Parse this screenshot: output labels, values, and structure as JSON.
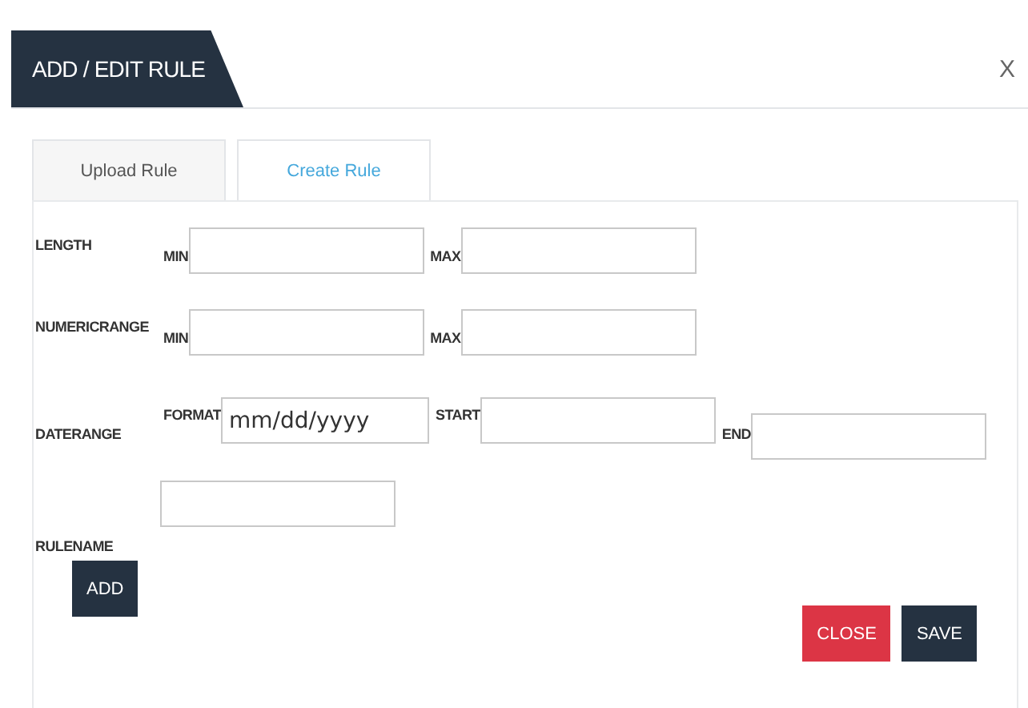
{
  "dialog": {
    "title": "ADD / EDIT RULE",
    "close_glyph": "X"
  },
  "tabs": [
    {
      "label": "Upload Rule",
      "selected": false
    },
    {
      "label": "Create Rule",
      "selected": true
    }
  ],
  "rows": [
    {
      "label": "LENGTH",
      "kind": "pair",
      "fields": [
        {
          "label": "MIN"
        },
        {
          "label": "MAX"
        }
      ]
    },
    {
      "label": "NUMERICRANGE",
      "kind": "pair",
      "fields": [
        {
          "label": "MIN"
        },
        {
          "label": "MAX"
        }
      ]
    },
    {
      "label": "DATERANGE",
      "kind": "date",
      "fields": [
        {
          "label": "FORMAT",
          "value": "mm/dd/yyyy"
        },
        {
          "label": "START"
        },
        {
          "label": "END"
        }
      ]
    },
    {
      "label": "RULENAME",
      "kind": "name"
    }
  ],
  "add_button": "ADD",
  "buttons": [
    {
      "label": "CLOSE",
      "kind": "danger"
    },
    {
      "label": "SAVE",
      "kind": "primary"
    }
  ]
}
